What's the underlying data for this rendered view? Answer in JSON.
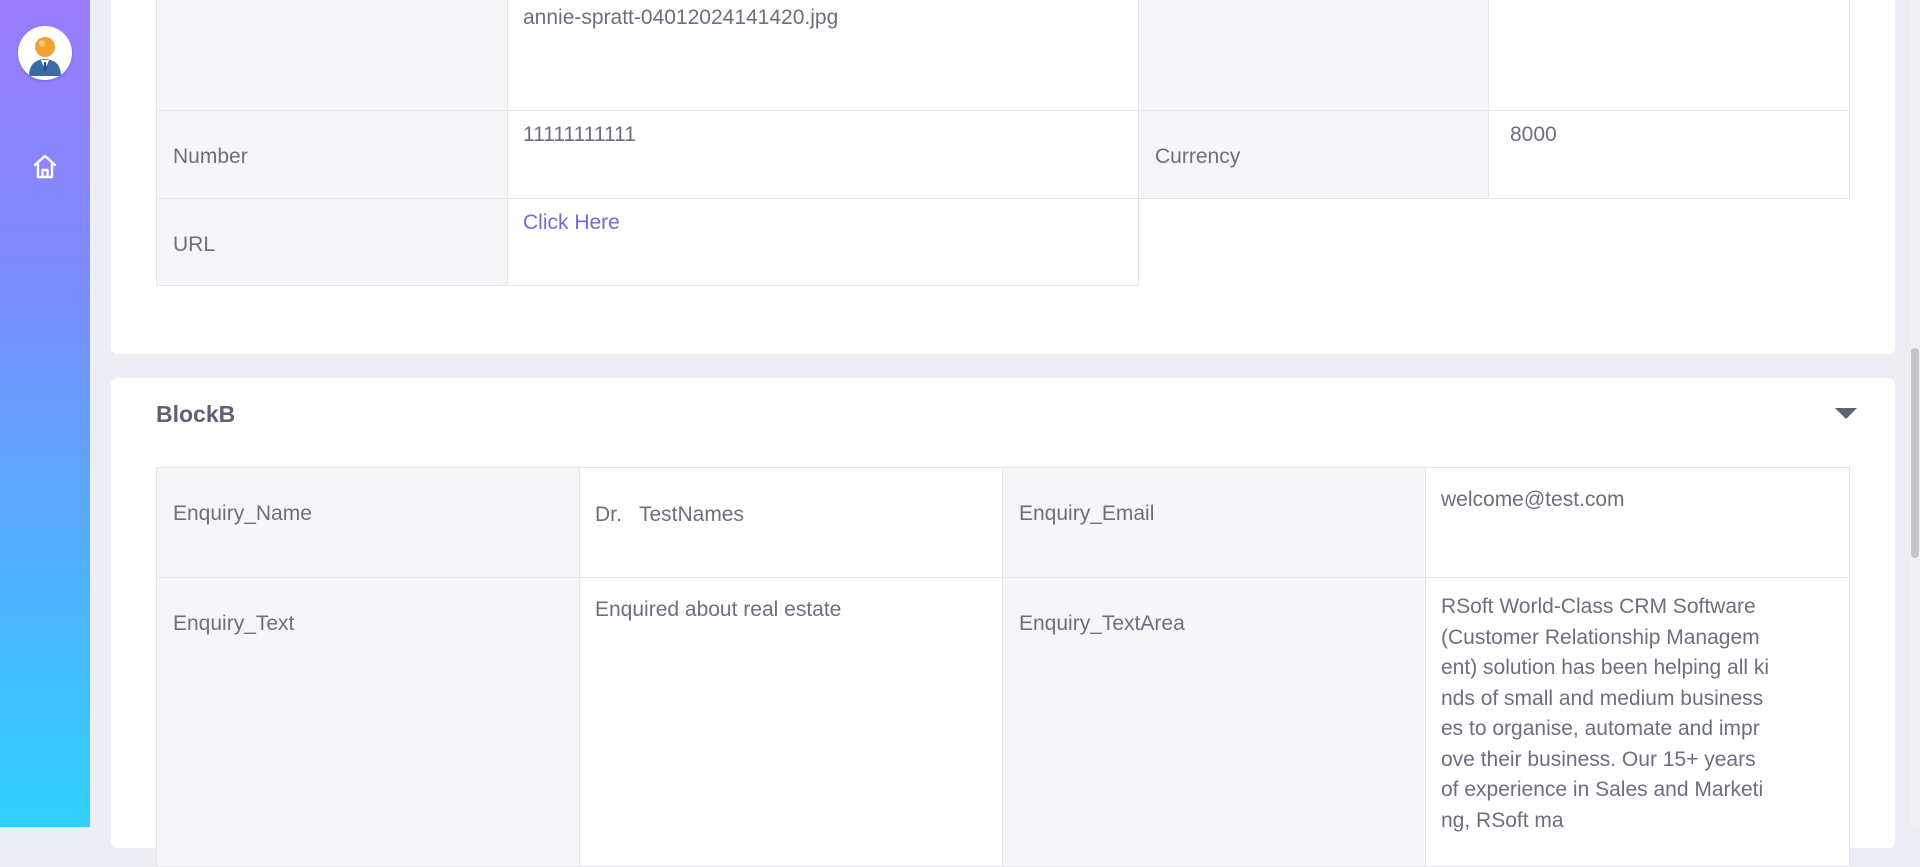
{
  "block_a": {
    "rows": [
      {
        "label": "",
        "value": "annie-spratt-04012024141420.jpg",
        "label2": "",
        "value2": ""
      },
      {
        "label": "Number",
        "value": "11111111111",
        "label2": "Currency",
        "value2": "8000"
      },
      {
        "label": "URL",
        "value": "Click Here"
      }
    ]
  },
  "block_b": {
    "title": "BlockB",
    "enquiry_name_label": "Enquiry_Name",
    "enquiry_name_value": "Dr.   TestNames",
    "enquiry_email_label": "Enquiry_Email",
    "enquiry_email_value": "welcome@test.com",
    "enquiry_text_label": "Enquiry_Text",
    "enquiry_text_value": "Enquired about real estate",
    "enquiry_textarea_label": "Enquiry_TextArea",
    "enquiry_textarea_value": "RSoft World-Class CRM Software (Customer Relationship Management) solution has been helping all kinds of small and medium businesses to organise, automate and improve their business. Our 15+ years of experience in Sales and Marketing, RSoft ma"
  },
  "icons": {
    "avatar": "user-avatar-icon",
    "home": "home-icon",
    "collapse": "caret-down-icon"
  },
  "colors": {
    "link": "#6f6cd6",
    "sidebar_top": "#9b7cff",
    "sidebar_bottom": "#2fd0ff"
  }
}
